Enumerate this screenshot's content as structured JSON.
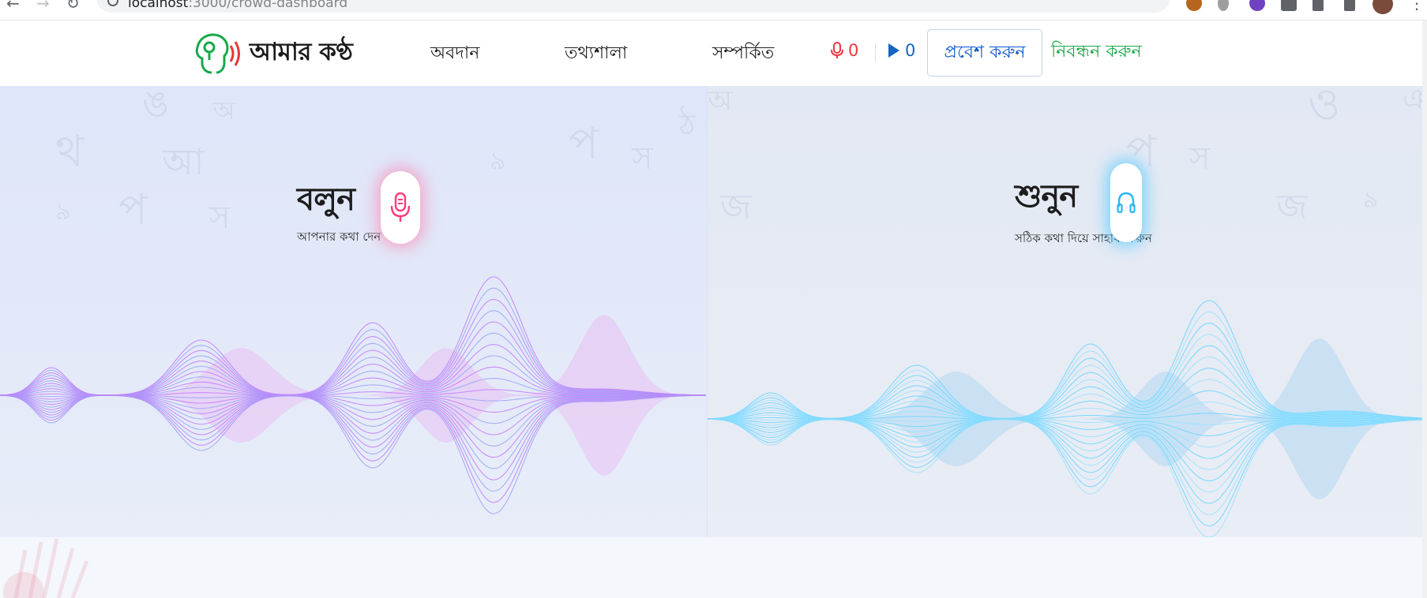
{
  "browser": {
    "url_host": "localhost",
    "url_rest": ":3000/crowd-dashboard"
  },
  "header": {
    "brand_name": "আমার কণ্ঠ",
    "nav": [
      "অবদান",
      "তথ্যশালা",
      "সম্পর্কিত"
    ],
    "speak_count": "0",
    "listen_count": "0",
    "login_label": "প্রবেশ করুন",
    "register_label": "নিবন্ধন করুন"
  },
  "speak_panel": {
    "title": "বলুন",
    "subtitle": "আপনার কথা দেন"
  },
  "listen_panel": {
    "title": "শুনুন",
    "subtitle": "সঠিক কথা দিয়ে সাহায্য করুন"
  },
  "colors": {
    "brand_green": "#17a84a",
    "link_blue": "#0b57d0",
    "speak_accent": "#ff3a7a",
    "listen_accent": "#29b6f6",
    "speak_wave": "#c77dff",
    "listen_wave": "#6fd6ff"
  },
  "icons": {
    "speak": "microphone-icon",
    "listen": "headphones-icon",
    "speak_counter": "microphone-icon",
    "listen_counter": "play-icon"
  }
}
